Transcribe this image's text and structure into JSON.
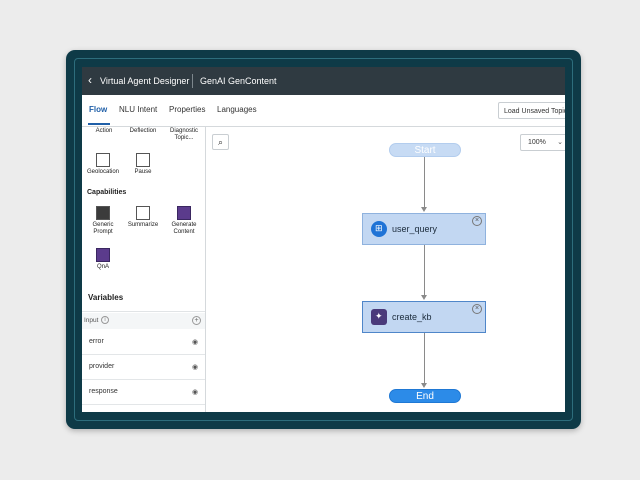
{
  "topbar": {
    "back_icon": "chevron-left-icon",
    "app_title": "Virtual Agent Designer",
    "topic_title": "GenAI GenContent"
  },
  "tabs": [
    {
      "label": "Flow",
      "active": true
    },
    {
      "label": "NLU Intent",
      "active": false
    },
    {
      "label": "Properties",
      "active": false
    },
    {
      "label": "Languages",
      "active": false
    }
  ],
  "load_button": "Load Unsaved Topic",
  "palette": {
    "top_row": [
      "Action",
      "Deflection",
      "Diagnostic Topic..."
    ],
    "row2": [
      "Geolocation",
      "Pause"
    ],
    "capabilities_header": "Capabilities",
    "capabilities": [
      "Generic Prompt",
      "Summarize",
      "Generate Content"
    ],
    "row4": [
      "QnA"
    ]
  },
  "variables": {
    "header": "Variables",
    "input_label": "Input",
    "items": [
      "error",
      "provider",
      "response"
    ]
  },
  "canvas": {
    "zoom": "100%",
    "nodes": {
      "start": "Start",
      "user_query": "user_query",
      "create_kb": "create_kb",
      "end": "End"
    }
  },
  "colors": {
    "frame": "#0e3a47",
    "topbar": "#2f3a41",
    "accent": "#1f5fa8",
    "node_fill": "#c2d7f2",
    "end_pill": "#2c8be8",
    "start_pill": "#c7dbf4"
  }
}
